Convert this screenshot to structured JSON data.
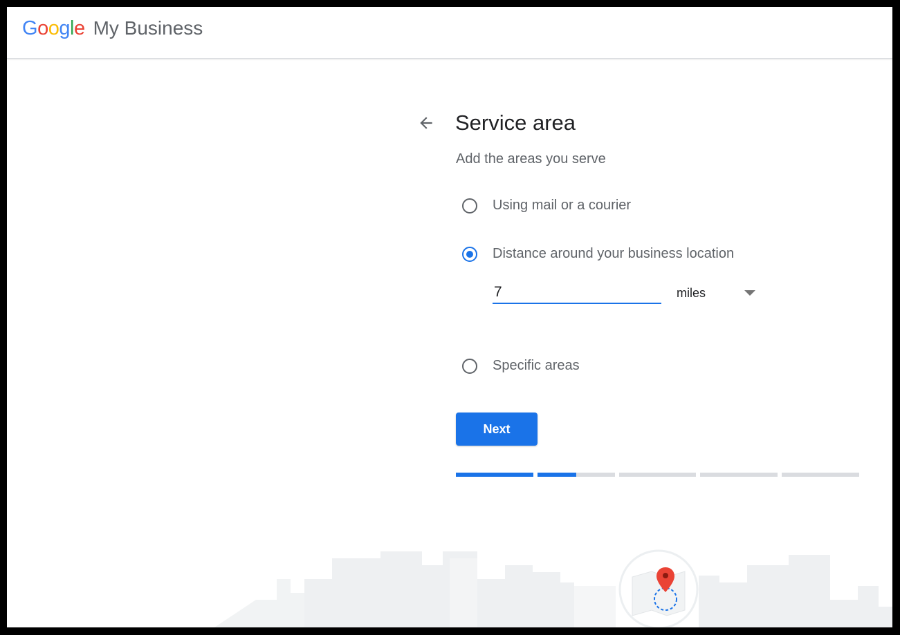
{
  "header": {
    "logo_letters": [
      "G",
      "o",
      "o",
      "g",
      "l",
      "e"
    ],
    "product_name": "My Business"
  },
  "page": {
    "back_icon": "arrow-left-icon",
    "title": "Service area",
    "subtitle": "Add the areas you serve"
  },
  "options": [
    {
      "label": "Using mail or a courier",
      "checked": false
    },
    {
      "label": "Distance around your business location",
      "checked": true
    },
    {
      "label": "Specific areas",
      "checked": false
    }
  ],
  "distance": {
    "value": "7",
    "unit": "miles"
  },
  "next_label": "Next",
  "progress": {
    "steps": 5,
    "current_step": 2,
    "current_step_fraction": 0.5
  },
  "colors": {
    "accent": "#1a73e8",
    "google_blue": "#4285f4",
    "google_red": "#ea4335",
    "google_yellow": "#fbbc05",
    "google_green": "#34a853",
    "pin": "#ea4335",
    "track": "#dadce0"
  },
  "illustration": {
    "skyline": "city-skyline-illustration",
    "badge": "map-pin-icon"
  }
}
